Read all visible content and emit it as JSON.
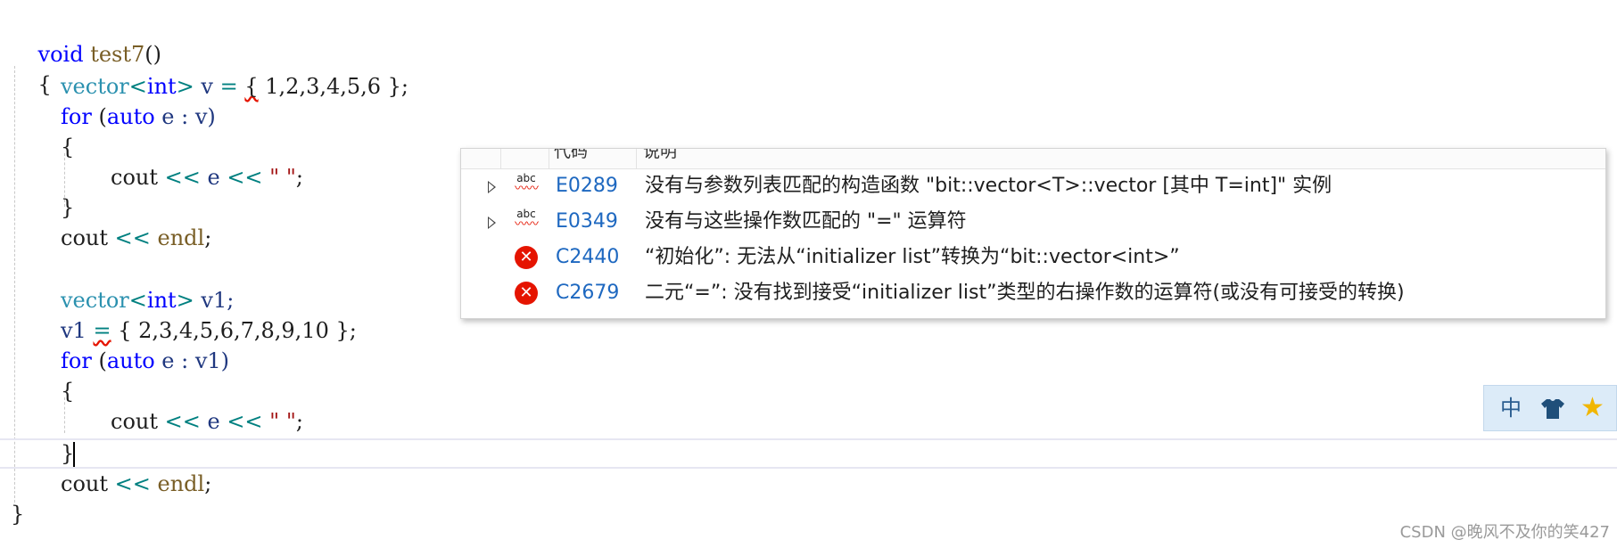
{
  "code": {
    "fn_decl": {
      "kw": "void",
      "name": "test7",
      "parens": "()"
    },
    "brace_open": "{",
    "brace_close": "}",
    "vector_v": {
      "type": "vector",
      "lt": "<",
      "tparam": "int",
      "gt": ">",
      "name": " v ",
      "eq": "=",
      "sp": " ",
      "lbrace": "{",
      "rest": " 1,2,3,4,5,6 };"
    },
    "for_v": {
      "kw": "for",
      "open": " (",
      "auto": "auto",
      "rest": " e : v)"
    },
    "inner_brace_open": "{",
    "cout_e": {
      "cout": "cout ",
      "op1": "<<",
      "e": " e ",
      "op2": "<<",
      "sp": " ",
      "str": "\" \"",
      "semi": ";"
    },
    "inner_brace_close": "}",
    "cout_endl": {
      "cout": "cout ",
      "op": "<<",
      "sp": " ",
      "endl": "endl",
      "semi": ";"
    },
    "vector_v1": {
      "type": "vector",
      "lt": "<",
      "tparam": "int",
      "gt": ">",
      "rest": " v1;"
    },
    "assign_v1": {
      "name": "v1 ",
      "eq": "=",
      "rest": " { 2,3,4,5,6,7,8,9,10 };"
    },
    "for_v1": {
      "kw": "for",
      "open": " (",
      "auto": "auto",
      "rest": " e : v1)"
    }
  },
  "error_list": {
    "header_code": "代码",
    "header_desc": "说明",
    "rows": [
      {
        "kind": "intellisense",
        "code": "E0289",
        "desc": "没有与参数列表匹配的构造函数 \"bit::vector<T>::vector [其中 T=int]\" 实例"
      },
      {
        "kind": "intellisense",
        "code": "E0349",
        "desc": "没有与这些操作数匹配的 \"=\" 运算符"
      },
      {
        "kind": "error",
        "code": "C2440",
        "desc": "“初始化”: 无法从“initializer list”转换为“bit::vector<int>”"
      },
      {
        "kind": "error",
        "code": "C2679",
        "desc": "二元“=”: 没有找到接受“initializer list”类型的右操作数的运算符(或没有可接受的转换)"
      }
    ],
    "abc_label": "abc",
    "error_glyph": "✕"
  },
  "ime": {
    "label": "中",
    "star_glyph": "★"
  },
  "watermark": "CSDN @晚风不及你的笑427",
  "colors": {
    "keyword": "#0000ff",
    "type": "#2b91af",
    "error": "#e51400",
    "code_link": "#1e68c0"
  }
}
